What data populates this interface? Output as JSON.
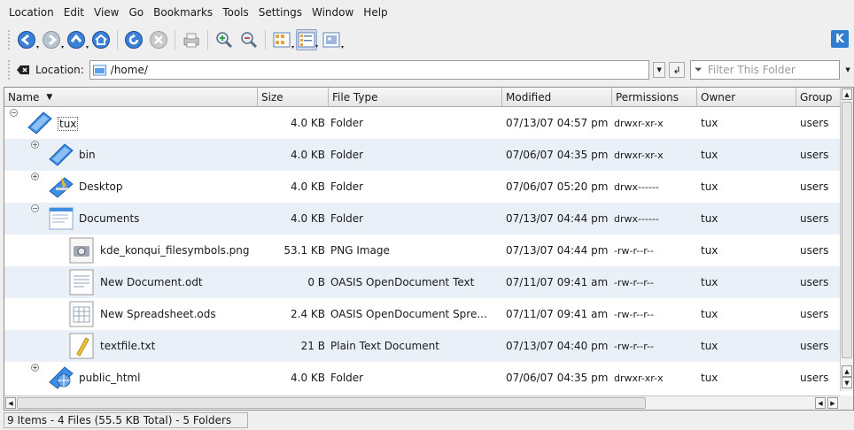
{
  "menu": {
    "location": "Location",
    "edit": "Edit",
    "view": "View",
    "go": "Go",
    "bookmarks": "Bookmarks",
    "tools": "Tools",
    "settings": "Settings",
    "window": "Window",
    "help": "Help"
  },
  "toolbar": {
    "icons": [
      "back-icon",
      "forward-icon",
      "up-icon",
      "home-icon",
      "reload-icon",
      "stop-icon",
      "print-icon",
      "zoom-in-icon",
      "zoom-out-icon",
      "icon-view-icon",
      "detail-view-icon",
      "preview-icon"
    ]
  },
  "location": {
    "label": "Location:",
    "value": "/home/",
    "filter_placeholder": "Filter This Folder"
  },
  "columns": [
    "Name",
    "Size",
    "File Type",
    "Modified",
    "Permissions",
    "Owner",
    "Group"
  ],
  "rows": [
    {
      "name": "tux",
      "size": "4.0 KB",
      "type": "Folder",
      "modified": "07/13/07 04:57 pm",
      "perms": "drwxr-xr-x",
      "owner": "tux",
      "group": "users"
    },
    {
      "name": "bin",
      "size": "4.0 KB",
      "type": "Folder",
      "modified": "07/06/07 04:35 pm",
      "perms": "drwxr-xr-x",
      "owner": "tux",
      "group": "users"
    },
    {
      "name": "Desktop",
      "size": "4.0 KB",
      "type": "Folder",
      "modified": "07/06/07 05:20 pm",
      "perms": "drwx------",
      "owner": "tux",
      "group": "users"
    },
    {
      "name": "Documents",
      "size": "4.0 KB",
      "type": "Folder",
      "modified": "07/13/07 04:44 pm",
      "perms": "drwx------",
      "owner": "tux",
      "group": "users"
    },
    {
      "name": "kde_konqui_filesymbols.png",
      "size": "53.1 KB",
      "type": "PNG Image",
      "modified": "07/13/07 04:44 pm",
      "perms": "-rw-r--r--",
      "owner": "tux",
      "group": "users"
    },
    {
      "name": "New Document.odt",
      "size": "0 B",
      "type": "OASIS OpenDocument Text",
      "modified": "07/11/07 09:41 am",
      "perms": "-rw-r--r--",
      "owner": "tux",
      "group": "users"
    },
    {
      "name": "New Spreadsheet.ods",
      "size": "2.4 KB",
      "type": "OASIS OpenDocument Spre...",
      "modified": "07/11/07 09:41 am",
      "perms": "-rw-r--r--",
      "owner": "tux",
      "group": "users"
    },
    {
      "name": "textfile.txt",
      "size": "21 B",
      "type": "Plain Text Document",
      "modified": "07/13/07 04:40 pm",
      "perms": "-rw-r--r--",
      "owner": "tux",
      "group": "users"
    },
    {
      "name": "public_html",
      "size": "4.0 KB",
      "type": "Folder",
      "modified": "07/06/07 04:35 pm",
      "perms": "drwxr-xr-x",
      "owner": "tux",
      "group": "users"
    }
  ],
  "status": "9 Items - 4 Files (55.5 KB Total) - 5 Folders",
  "colors": {
    "row_alt": "#e9f0f8",
    "folder_blue": "#3f8ee6",
    "accent": "#2f7ed0"
  }
}
